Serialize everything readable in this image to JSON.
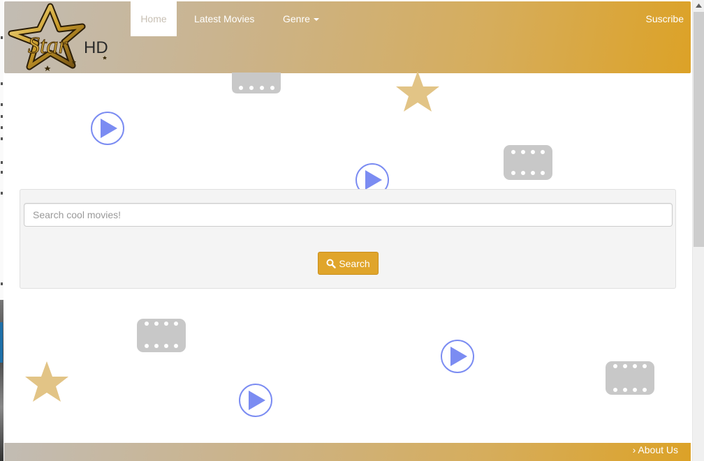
{
  "logo": {
    "text_main": "Star",
    "text_suffix": "HD"
  },
  "nav": {
    "home": "Home",
    "latest": "Latest Movies",
    "genre": "Genre",
    "subscribe": "Suscribe"
  },
  "search": {
    "placeholder": "Search cool movies!",
    "button_label": "Search"
  },
  "footer": {
    "about": "› About Us"
  },
  "colors": {
    "accent": "#e0a52b",
    "play_icon": "#7b8cf2",
    "film_icon": "#c8c8c8",
    "star_icon": "#e2c486"
  },
  "decorations": [
    "play-icon",
    "film-strip-icon",
    "star-icon"
  ]
}
